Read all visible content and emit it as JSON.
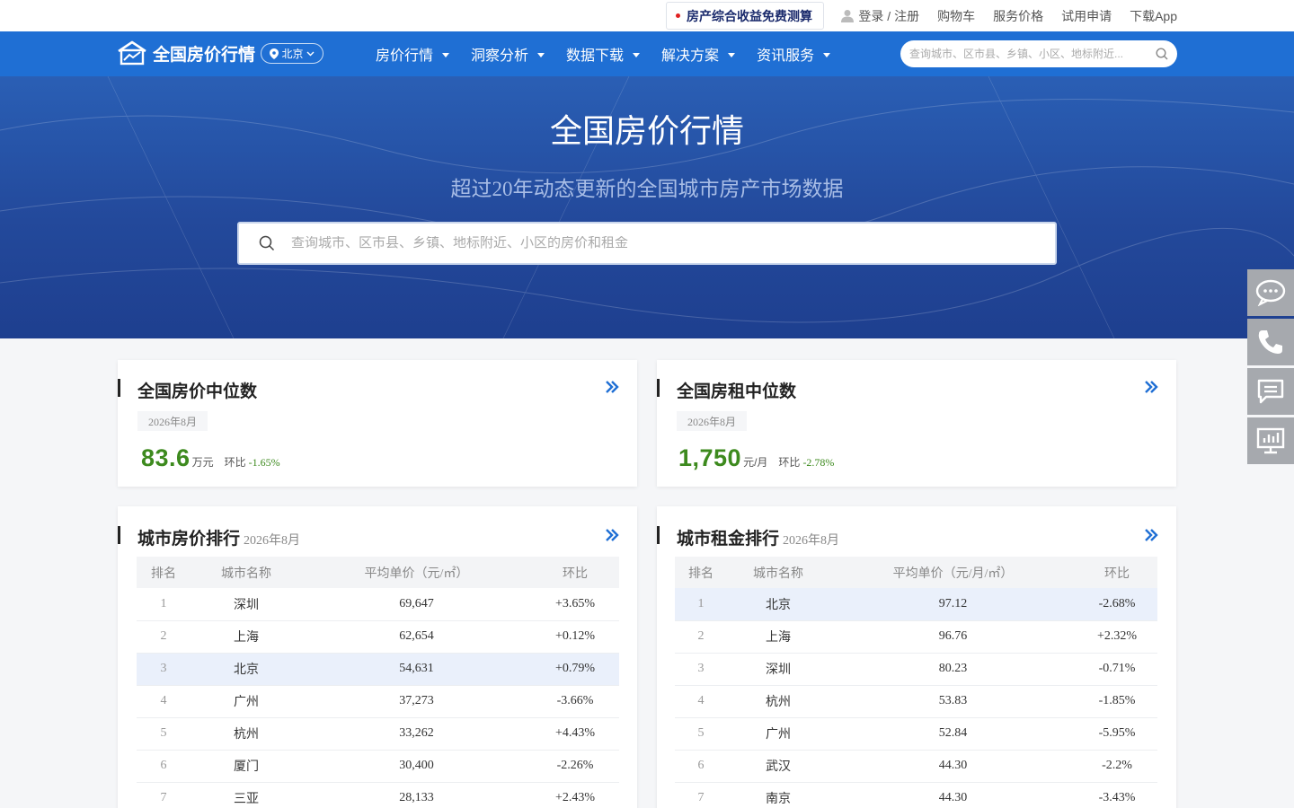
{
  "topbar": {
    "promo": "房产综合收益免费测算",
    "links": [
      "登录 / 注册",
      "购物车",
      "服务价格",
      "试用申请",
      "下载App"
    ]
  },
  "nav": {
    "logo_text": "全国房价行情",
    "city": "北京",
    "menu": [
      "房价行情",
      "洞察分析",
      "数据下载",
      "解决方案",
      "资讯服务"
    ],
    "search_placeholder": "查询城市、区市县、乡镇、小区、地标附近..."
  },
  "hero": {
    "title": "全国房价行情",
    "subtitle": "超过20年动态更新的全国城市房产市场数据",
    "search_placeholder": "查询城市、区市县、乡镇、地标附近、小区的房价和租金"
  },
  "cards": {
    "price_median": {
      "title": "全国房价中位数",
      "date": "2026年8月",
      "value": "83.6",
      "unit": "万元",
      "hb_label": "环比",
      "hb_value": "-1.65%"
    },
    "rent_median": {
      "title": "全国房租中位数",
      "date": "2026年8月",
      "value": "1,750",
      "unit": "元/月",
      "hb_label": "环比",
      "hb_value": "-2.78%"
    }
  },
  "price_rank": {
    "title": "城市房价排行",
    "date": "2026年8月",
    "headers": [
      "排名",
      "城市名称",
      "平均单价（元/㎡）",
      "环比"
    ],
    "rows": [
      {
        "rank": "1",
        "city": "深圳",
        "price": "69,647",
        "change": "+3.65%",
        "trend": "up"
      },
      {
        "rank": "2",
        "city": "上海",
        "price": "62,654",
        "change": "+0.12%",
        "trend": "up"
      },
      {
        "rank": "3",
        "city": "北京",
        "price": "54,631",
        "change": "+0.79%",
        "trend": "up"
      },
      {
        "rank": "4",
        "city": "广州",
        "price": "37,273",
        "change": "-3.66%",
        "trend": "down"
      },
      {
        "rank": "5",
        "city": "杭州",
        "price": "33,262",
        "change": "+4.43%",
        "trend": "up"
      },
      {
        "rank": "6",
        "city": "厦门",
        "price": "30,400",
        "change": "-2.26%",
        "trend": "down"
      },
      {
        "rank": "7",
        "city": "三亚",
        "price": "28,133",
        "change": "+2.43%",
        "trend": "up"
      }
    ]
  },
  "rent_rank": {
    "title": "城市租金排行",
    "date": "2026年8月",
    "headers": [
      "排名",
      "城市名称",
      "平均单价（元/月/㎡）",
      "环比"
    ],
    "rows": [
      {
        "rank": "1",
        "city": "北京",
        "price": "97.12",
        "change": "-2.68%",
        "trend": "down"
      },
      {
        "rank": "2",
        "city": "上海",
        "price": "96.76",
        "change": "+2.32%",
        "trend": "up"
      },
      {
        "rank": "3",
        "city": "深圳",
        "price": "80.23",
        "change": "-0.71%",
        "trend": "down"
      },
      {
        "rank": "4",
        "city": "杭州",
        "price": "53.83",
        "change": "-1.85%",
        "trend": "down"
      },
      {
        "rank": "5",
        "city": "广州",
        "price": "52.84",
        "change": "-5.95%",
        "trend": "down"
      },
      {
        "rank": "6",
        "city": "武汉",
        "price": "44.30",
        "change": "-2.2%",
        "trend": "down"
      },
      {
        "rank": "7",
        "city": "南京",
        "price": "44.30",
        "change": "-3.43%",
        "trend": "down"
      }
    ]
  },
  "side_tools": [
    "chat-icon",
    "phone-icon",
    "message-icon",
    "presentation-icon"
  ],
  "colors": {
    "nav_blue": "#1f6fd4",
    "up_red": "#d8263c",
    "down_green": "#3d8a1e"
  }
}
